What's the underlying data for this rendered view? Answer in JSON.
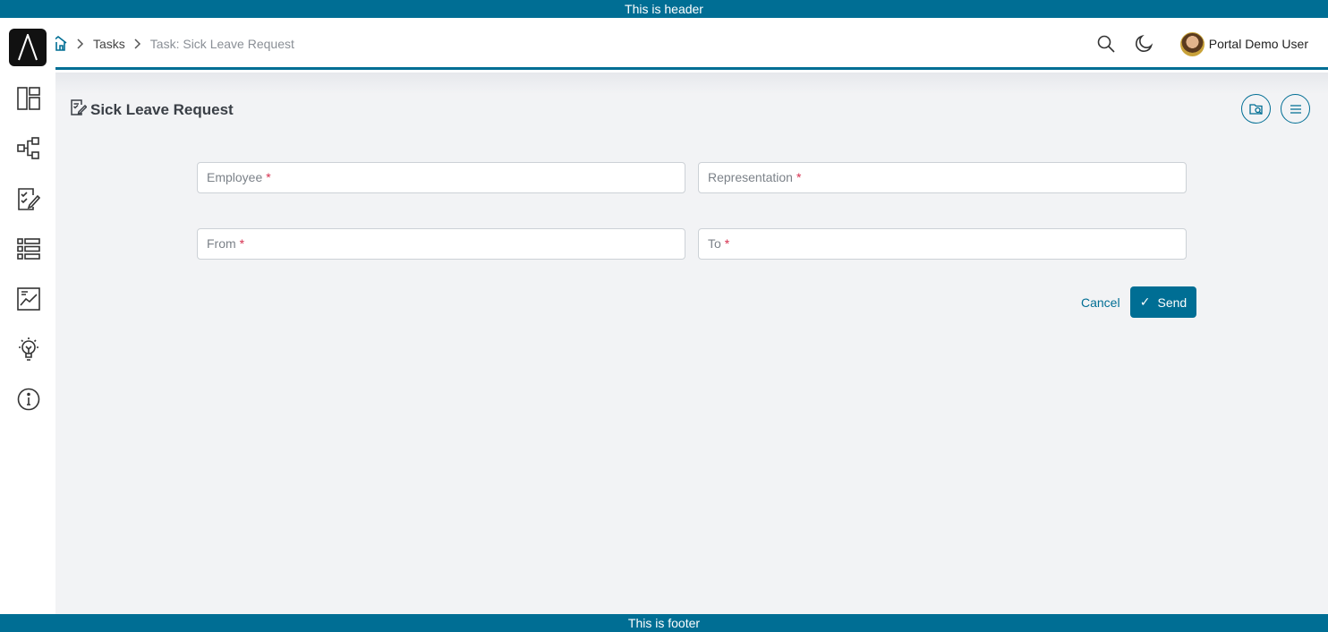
{
  "banners": {
    "header": "This is header",
    "footer": "This is footer"
  },
  "sidebar": {
    "logo": "logo-icon",
    "items": [
      {
        "icon": "dashboard-icon"
      },
      {
        "icon": "process-icon"
      },
      {
        "icon": "task-list-icon"
      },
      {
        "icon": "list-icon"
      },
      {
        "icon": "statistics-icon"
      },
      {
        "icon": "lightbulb-icon"
      },
      {
        "icon": "info-icon"
      }
    ]
  },
  "breadcrumb": {
    "home_icon": "home-icon",
    "items": [
      "Tasks",
      "Task: Sick Leave Request"
    ]
  },
  "topbar": {
    "user_name": "Portal Demo User"
  },
  "page": {
    "title": "Sick Leave Request"
  },
  "form": {
    "employee": {
      "label": "Employee",
      "required": "*"
    },
    "representation": {
      "label": "Representation",
      "required": "*"
    },
    "from": {
      "label": "From",
      "required": "*"
    },
    "to": {
      "label": "To",
      "required": "*"
    },
    "cancel_label": "Cancel",
    "send_label": "Send",
    "send_check": "✓"
  },
  "colors": {
    "accent": "#006e94",
    "background": "#f2f3f5",
    "required": "#d6304f"
  }
}
